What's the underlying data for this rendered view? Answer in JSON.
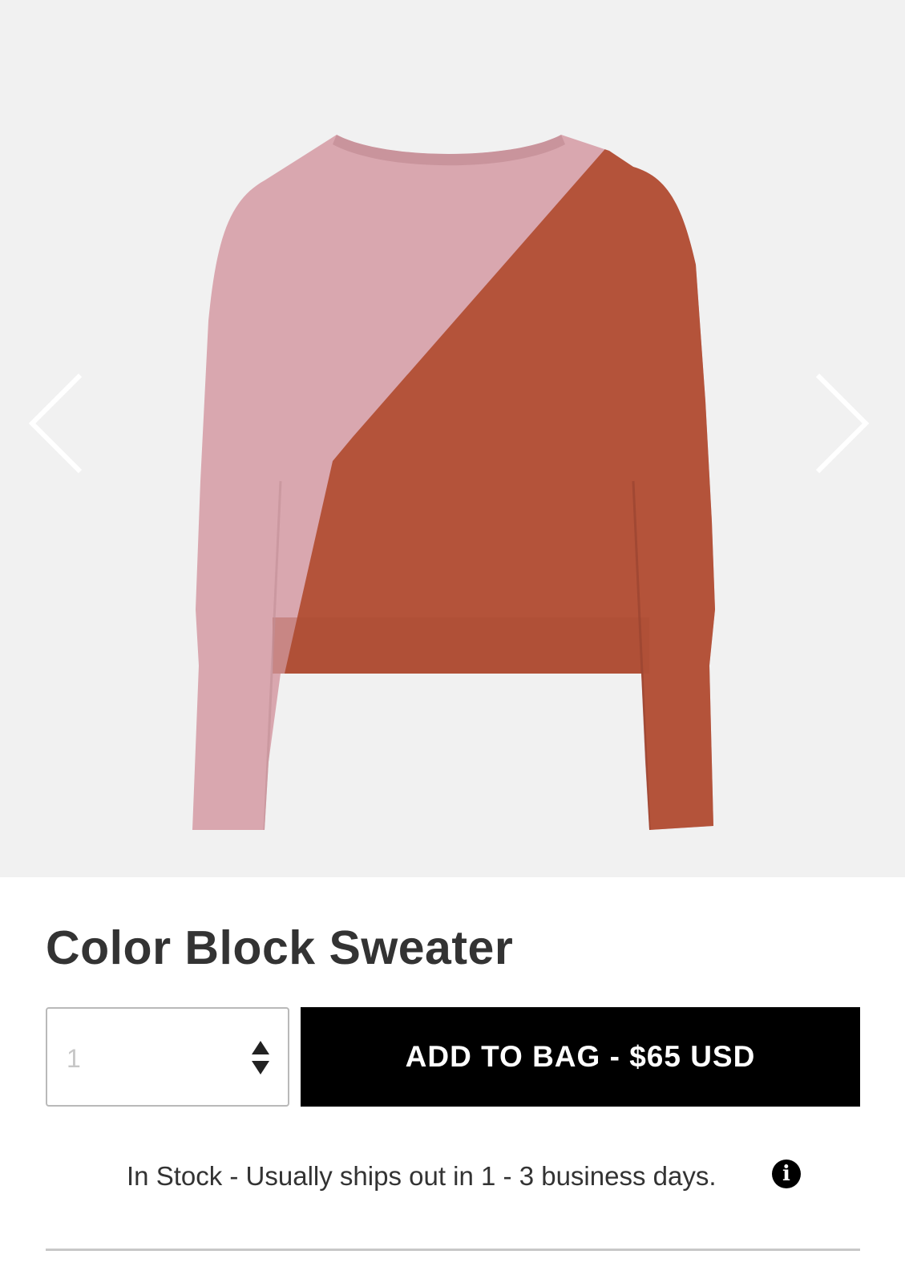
{
  "gallery": {
    "image_alt": "Color Block Sweater",
    "prev_icon": "chevron-left-icon",
    "next_icon": "chevron-right-icon",
    "colors": {
      "background": "#f1f1f1",
      "pink": "#d9a7af",
      "rust": "#b4533a",
      "arrow": "#ffffff"
    }
  },
  "product": {
    "title": "Color Block Sweater"
  },
  "quantity": {
    "placeholder": "1",
    "stepper_icon": "up-down-arrows-icon"
  },
  "cta": {
    "label": "ADD TO BAG - $65 USD",
    "background": "#000000"
  },
  "stock": {
    "text": "In Stock - Usually ships out in 1 - 3 business days.",
    "info_icon": "info-icon",
    "info_glyph": "i"
  }
}
